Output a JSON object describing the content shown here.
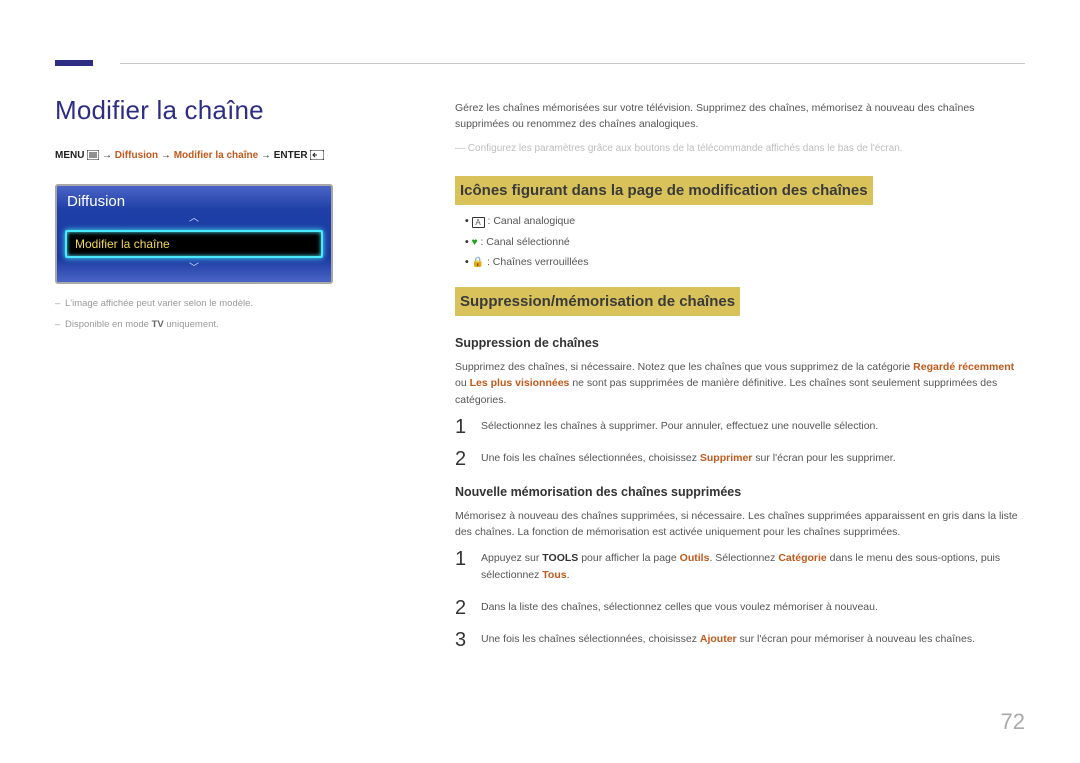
{
  "page_number": "72",
  "left": {
    "title": "Modifier la chaîne",
    "breadcrumb": {
      "menu": "MENU",
      "arrow": " → ",
      "hl1": "Diffusion",
      "hl2": "Modifier la chaîne",
      "enter": "ENTER"
    },
    "mini": {
      "header": "Diffusion",
      "row": "Modifier la chaîne"
    },
    "captions": {
      "c1": "L'image affichée peut varier selon le modèle.",
      "c2_pre": "Disponible en mode ",
      "c2_tv": "TV",
      "c2_post": " uniquement."
    }
  },
  "right": {
    "intro": "Gérez les chaînes mémorisées sur votre télévision. Supprimez des chaînes, mémorisez à nouveau des chaînes supprimées ou renommez des chaînes analogiques.",
    "subnote": "Configurez les paramètres grâce aux boutons de la télécommande affichés dans le bas de l'écran.",
    "sec1_title": "Icônes figurant dans la page de modification des chaînes",
    "icons": {
      "a_label": "A",
      "a_text": " : Canal analogique",
      "heart_text": " : Canal sélectionné",
      "lock_text": " : Chaînes verrouillées"
    },
    "sec2_title": "Suppression/mémorisation de chaînes",
    "sub1_title": "Suppression de chaînes",
    "sub1_para_pre": "Supprimez des chaînes, si nécessaire. Notez que les chaînes que vous supprimez de la catégorie ",
    "sub1_em1": "Regardé récemment",
    "sub1_mid": " ou ",
    "sub1_em2": "Les plus visionnées",
    "sub1_para_post": " ne sont pas supprimées de manière définitive. Les chaînes sont seulement supprimées des catégories.",
    "sub1_steps": {
      "s1": "Sélectionnez les chaînes à supprimer. Pour annuler, effectuez une nouvelle sélection.",
      "s2_pre": "Une fois les chaînes sélectionnées, choisissez ",
      "s2_em": "Supprimer",
      "s2_post": " sur l'écran pour les supprimer."
    },
    "sub2_title": "Nouvelle mémorisation des chaînes supprimées",
    "sub2_para": "Mémorisez à nouveau des chaînes supprimées, si nécessaire. Les chaînes supprimées apparaissent en gris dans la liste des chaînes. La fonction de mémorisation est activée uniquement pour les chaînes supprimées.",
    "sub2_steps": {
      "s1_pre": "Appuyez sur ",
      "s1_tools": "TOOLS",
      "s1_mid1": " pour afficher la page ",
      "s1_em1": "Outils",
      "s1_mid2": ". Sélectionnez ",
      "s1_em2": "Catégorie",
      "s1_mid3": " dans le menu des sous-options, puis sélectionnez ",
      "s1_em3": "Tous",
      "s1_post": ".",
      "s2": "Dans la liste des chaînes, sélectionnez celles que vous voulez mémoriser à nouveau.",
      "s3_pre": "Une fois les chaînes sélectionnées, choisissez ",
      "s3_em": "Ajouter",
      "s3_post": " sur l'écran pour mémoriser à nouveau les chaînes."
    }
  }
}
